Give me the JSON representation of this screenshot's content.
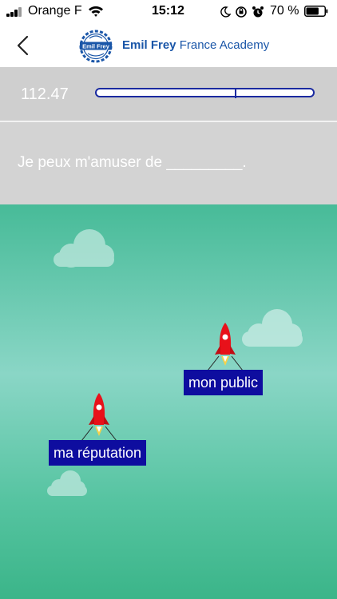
{
  "status_bar": {
    "carrier": "Orange F",
    "time": "15:12",
    "battery_percent": "70 %",
    "battery_level": 0.7
  },
  "header": {
    "logo_text": "Emil Frey",
    "brand_bold": "Emil Frey",
    "brand_rest": "France Academy"
  },
  "timer": {
    "value": "112.47",
    "progress_fraction": 0.64
  },
  "question": {
    "text": "Je peux m'amuser de _________."
  },
  "answers": [
    {
      "label": "mon public"
    },
    {
      "label": "ma réputation"
    }
  ],
  "colors": {
    "brand_blue": "#1a56a8",
    "answer_bg": "#0e0d9f",
    "rocket_red": "#e8111a",
    "sky_top": "#47bb98",
    "sky_mid": "#8ad6c6",
    "sky_bottom": "#3bb589"
  }
}
